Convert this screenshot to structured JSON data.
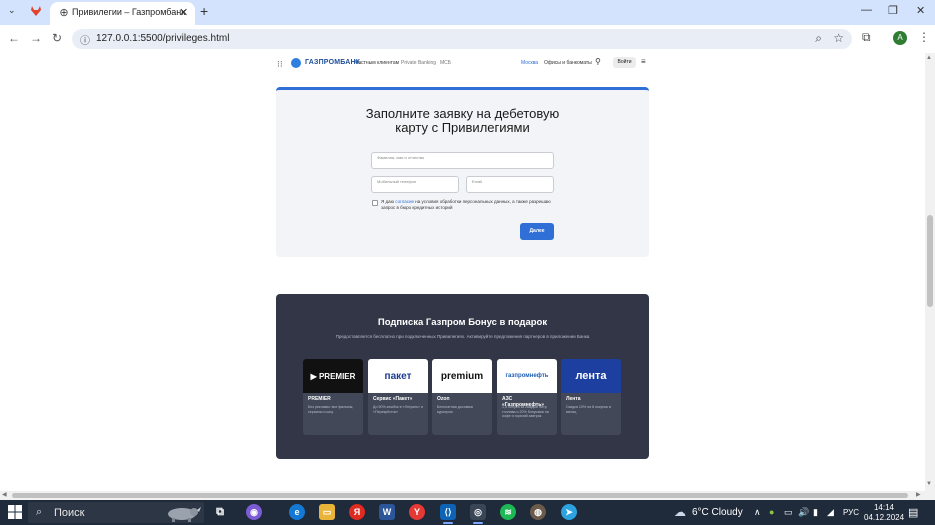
{
  "browser": {
    "tab_title": "Привилегии – Газпромбанк",
    "url": "127.0.0.1:5500/privileges.html",
    "profile_initial": "A"
  },
  "site_nav": {
    "logo": "ГАЗПРОМБАНК",
    "links": [
      "Частным клиентам",
      "Private Banking",
      "МСБ"
    ],
    "city": "Москва",
    "offices": "Офисы и банкоматы",
    "login": "Войти"
  },
  "form": {
    "title_line1": "Заполните заявку на дебетовую",
    "title_line2": "карту с Привилегиями",
    "fio_placeholder": "Фамилия, имя и отчество",
    "phone_placeholder": "Мобильный телефон",
    "email_placeholder": "Email",
    "consent_prefix": "Я даю ",
    "consent_link": "согласие",
    "consent_suffix": " на условия обработки персональных данных, а также разрешаю запрос в бюро кредитных историй",
    "submit": "Далее"
  },
  "bonus": {
    "title": "Подписка Газпром Бонус в подарок",
    "subtitle": "Предоставляется бесплатно при подключенных Привилегиях. Активируйте предложения партнеров в приложении Банка",
    "partners": [
      {
        "logo": "▶ PREMIER",
        "name": "PREMIER",
        "desc": "Без рекламы: все фильмы, сериалы и шоу",
        "bg": "#111111",
        "fg": "#ffffff"
      },
      {
        "logo": "пакет",
        "name": "Сервис «Пакет»",
        "desc": "До 50% кешбэк в «Лэтуаль» и «Перекрёсток»",
        "bg": "#ffffff",
        "fg": "#1a3b8f"
      },
      {
        "logo": "premium",
        "name": "Ozon",
        "desc": "Бесплатная доставка курьером",
        "bg": "#ffffff",
        "fg": "#111111"
      },
      {
        "logo": "газпромнефть",
        "name": "АЗС «Газпромнефть»",
        "desc": "1,5 бонуса за каждый литр топлива и 20% бонусами на кофе и горячий завтрак",
        "bg": "#ffffff",
        "fg": "#1e5fb4"
      },
      {
        "logo": "лента",
        "name": "Лента",
        "desc": "Скидка 10% на 8 покупок в месяц",
        "bg": "#1d3fa0",
        "fg": "#ffffff"
      }
    ]
  },
  "taskbar": {
    "search_placeholder": "Поиск",
    "weather": "6°C  Cloudy",
    "lang": "РУС",
    "time": "14:14",
    "date": "04.12.2024"
  }
}
